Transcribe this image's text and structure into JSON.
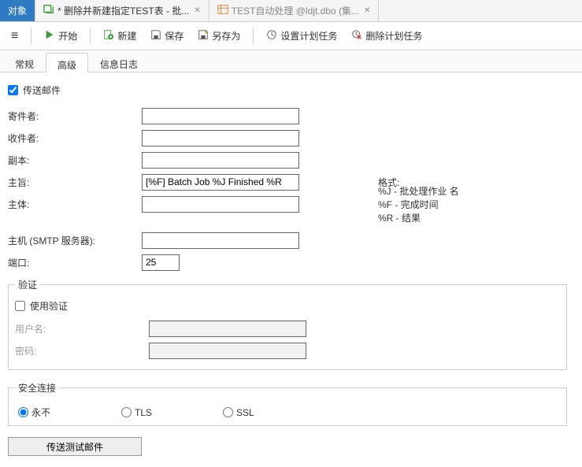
{
  "tabs": {
    "objects": "对象",
    "batch": "* 删除并新建指定TEST表 - 批...",
    "auto": "TEST自动处理 @ldjt.dbo (集..."
  },
  "toolbar": {
    "start": "开始",
    "new": "新建",
    "save": "保存",
    "saveas": "另存为",
    "schedule": "设置计划任务",
    "delete": "删除计划任务"
  },
  "subtabs": {
    "general": "常规",
    "advanced": "高级",
    "log": "信息日志"
  },
  "mail": {
    "send_checkbox": "传送邮件",
    "from": "寄件者:",
    "to": "收件者:",
    "cc": "副本:",
    "subject_label": "主旨:",
    "subject_value": "[%F] Batch Job %J Finished %R",
    "body": "主体:",
    "format_header": "格式:",
    "format_j": "%J - 批处理作业 名",
    "format_f": "%F - 完成时间",
    "format_r": "%R - 结果"
  },
  "smtp": {
    "host_label": "主机 (SMTP 服务器):",
    "port_label": "端口:",
    "port_value": "25"
  },
  "auth": {
    "legend": "验证",
    "use_auth": "使用验证",
    "username": "用户名:",
    "password": "密码:"
  },
  "security": {
    "legend": "安全连接",
    "never": "永不",
    "tls": "TLS",
    "ssl": "SSL"
  },
  "send_test": "传送测试邮件"
}
